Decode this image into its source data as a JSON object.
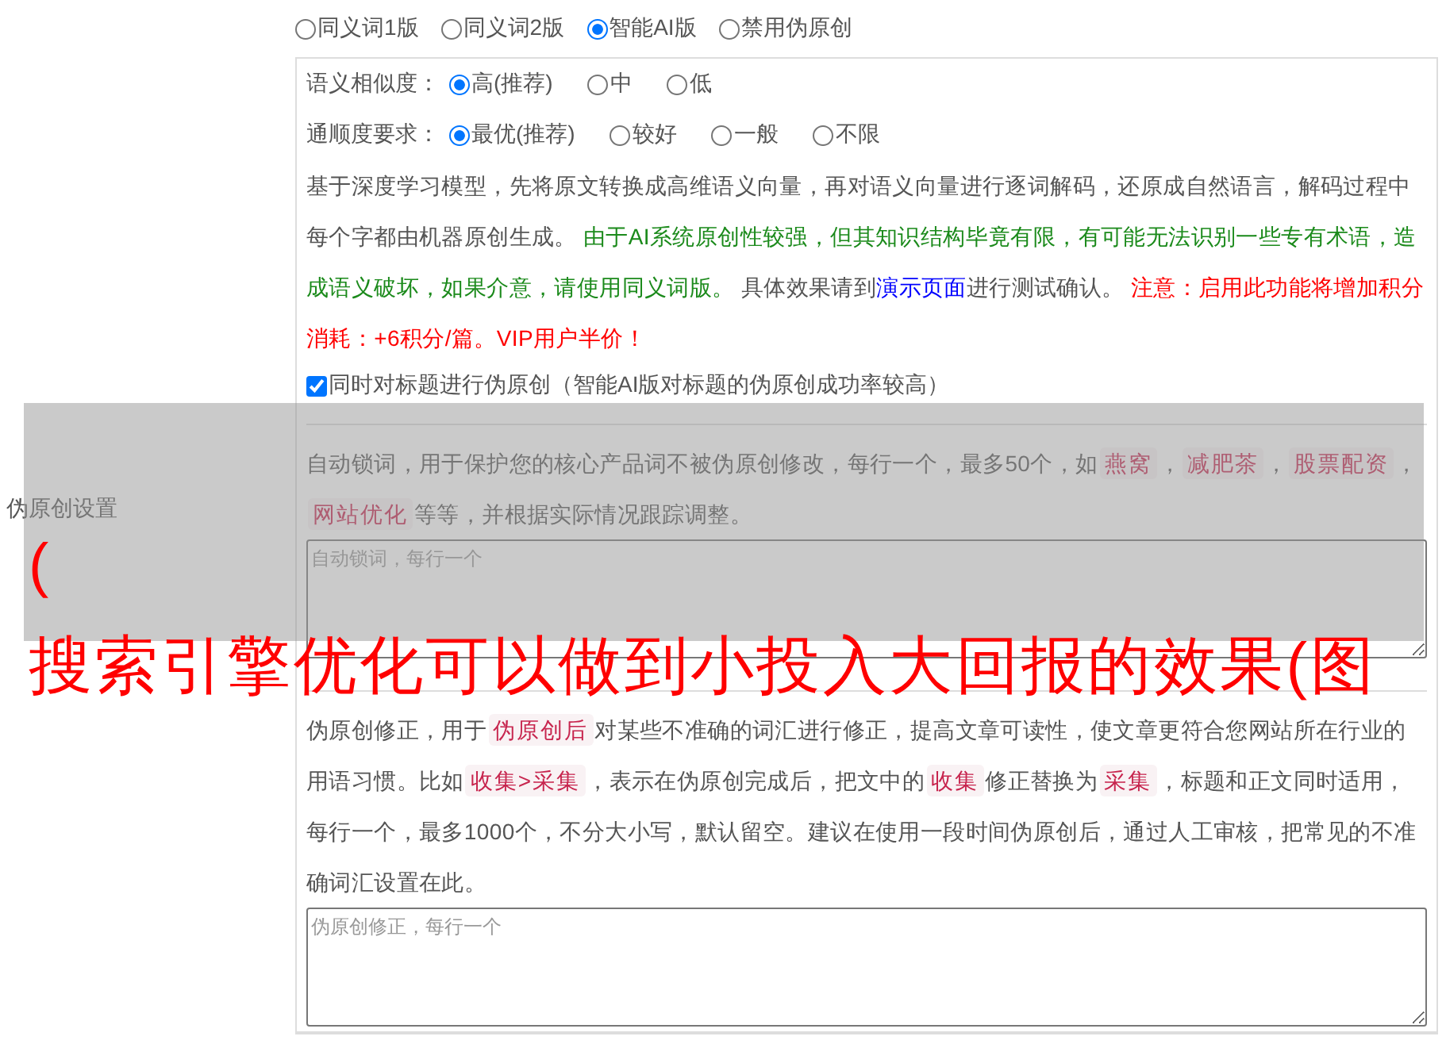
{
  "section_label": "伪原创设置",
  "modes": [
    {
      "label": "同义词1版",
      "selected": false
    },
    {
      "label": "同义词2版",
      "selected": false
    },
    {
      "label": "智能AI版",
      "selected": true
    },
    {
      "label": "禁用伪原创",
      "selected": false
    }
  ],
  "similarity": {
    "label": "语义相似度：",
    "options": [
      {
        "label": "高(推荐)",
        "selected": true
      },
      {
        "label": "中",
        "selected": false
      },
      {
        "label": "低",
        "selected": false
      }
    ]
  },
  "fluency": {
    "label": "通顺度要求：",
    "options": [
      {
        "label": "最优(推荐)",
        "selected": true
      },
      {
        "label": "较好",
        "selected": false
      },
      {
        "label": "一般",
        "selected": false
      },
      {
        "label": "不限",
        "selected": false
      }
    ]
  },
  "ai_description": [
    {
      "kind": "plain",
      "text": "基于深度学习模型，先将原文转换成高维语义向量，再对语义向量进行逐词解码，还原成自然语言，解码过程中每个字都由机器原创生成。"
    },
    {
      "kind": "green",
      "text": "由于AI系统原创性较强，但其知识结构毕竟有限，有可能无法识别一些专有术语，造成语义破坏，如果介意，请使用同义词版。"
    },
    {
      "kind": "plain",
      "text": "具体效果请到"
    },
    {
      "kind": "link",
      "text": "演示页面"
    },
    {
      "kind": "plain",
      "text": "进行测试确认。"
    },
    {
      "kind": "red",
      "text": "注意：启用此功能将增加积分消耗：+6积分/篇。VIP用户半价！"
    }
  ],
  "title_option": {
    "label": "同时对标题进行伪原创（智能AI版对标题的伪原创成功率较高）",
    "checked": true
  },
  "lock_words": {
    "description": [
      {
        "kind": "plain",
        "text": "自动锁词，用于保护您的核心产品词不被伪原创修改，每行一个，最多50个，如"
      },
      {
        "kind": "tag",
        "text": "燕窝"
      },
      {
        "kind": "plain",
        "text": "，"
      },
      {
        "kind": "tag",
        "text": "减肥茶"
      },
      {
        "kind": "plain",
        "text": "，"
      },
      {
        "kind": "tag",
        "text": "股票配资"
      },
      {
        "kind": "plain",
        "text": "，"
      },
      {
        "kind": "tag",
        "text": "网站优化"
      },
      {
        "kind": "plain",
        "text": "等等，并根据实际情况跟踪调整。"
      }
    ],
    "placeholder": "自动锁词，每行一个"
  },
  "corrections": {
    "description": [
      {
        "kind": "plain",
        "text": "伪原创修正，用于"
      },
      {
        "kind": "tag",
        "text": "伪原创后"
      },
      {
        "kind": "plain",
        "text": "对某些不准确的词汇进行修正，提高文章可读性，使文章更符合您网站所在行业的用语习惯。比如"
      },
      {
        "kind": "tag",
        "text": "收集>采集"
      },
      {
        "kind": "plain",
        "text": "，表示在伪原创完成后，把文中的"
      },
      {
        "kind": "tag",
        "text": "收集"
      },
      {
        "kind": "plain",
        "text": "修正替换为"
      },
      {
        "kind": "tag",
        "text": "采集"
      },
      {
        "kind": "plain",
        "text": "，标题和正文同时适用，每行一个，最多1000个，不分大小写，默认留空。建议在使用一段时间伪原创后，通过人工审核，把常见的不准确词汇设置在此。"
      }
    ],
    "placeholder": "伪原创修正，每行一个"
  },
  "overlay": {
    "line_1": "(",
    "line_2": "搜索引擎优化可以做到小投入大回报的效果(图"
  }
}
